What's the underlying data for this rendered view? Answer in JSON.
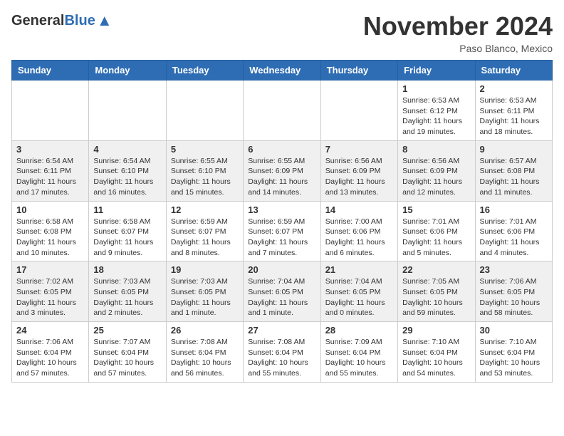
{
  "header": {
    "logo_general": "General",
    "logo_blue": "Blue",
    "month_title": "November 2024",
    "location": "Paso Blanco, Mexico"
  },
  "days_of_week": [
    "Sunday",
    "Monday",
    "Tuesday",
    "Wednesday",
    "Thursday",
    "Friday",
    "Saturday"
  ],
  "weeks": [
    [
      {
        "day": "",
        "info": ""
      },
      {
        "day": "",
        "info": ""
      },
      {
        "day": "",
        "info": ""
      },
      {
        "day": "",
        "info": ""
      },
      {
        "day": "",
        "info": ""
      },
      {
        "day": "1",
        "info": "Sunrise: 6:53 AM\nSunset: 6:12 PM\nDaylight: 11 hours and 19 minutes."
      },
      {
        "day": "2",
        "info": "Sunrise: 6:53 AM\nSunset: 6:11 PM\nDaylight: 11 hours and 18 minutes."
      }
    ],
    [
      {
        "day": "3",
        "info": "Sunrise: 6:54 AM\nSunset: 6:11 PM\nDaylight: 11 hours and 17 minutes."
      },
      {
        "day": "4",
        "info": "Sunrise: 6:54 AM\nSunset: 6:10 PM\nDaylight: 11 hours and 16 minutes."
      },
      {
        "day": "5",
        "info": "Sunrise: 6:55 AM\nSunset: 6:10 PM\nDaylight: 11 hours and 15 minutes."
      },
      {
        "day": "6",
        "info": "Sunrise: 6:55 AM\nSunset: 6:09 PM\nDaylight: 11 hours and 14 minutes."
      },
      {
        "day": "7",
        "info": "Sunrise: 6:56 AM\nSunset: 6:09 PM\nDaylight: 11 hours and 13 minutes."
      },
      {
        "day": "8",
        "info": "Sunrise: 6:56 AM\nSunset: 6:09 PM\nDaylight: 11 hours and 12 minutes."
      },
      {
        "day": "9",
        "info": "Sunrise: 6:57 AM\nSunset: 6:08 PM\nDaylight: 11 hours and 11 minutes."
      }
    ],
    [
      {
        "day": "10",
        "info": "Sunrise: 6:58 AM\nSunset: 6:08 PM\nDaylight: 11 hours and 10 minutes."
      },
      {
        "day": "11",
        "info": "Sunrise: 6:58 AM\nSunset: 6:07 PM\nDaylight: 11 hours and 9 minutes."
      },
      {
        "day": "12",
        "info": "Sunrise: 6:59 AM\nSunset: 6:07 PM\nDaylight: 11 hours and 8 minutes."
      },
      {
        "day": "13",
        "info": "Sunrise: 6:59 AM\nSunset: 6:07 PM\nDaylight: 11 hours and 7 minutes."
      },
      {
        "day": "14",
        "info": "Sunrise: 7:00 AM\nSunset: 6:06 PM\nDaylight: 11 hours and 6 minutes."
      },
      {
        "day": "15",
        "info": "Sunrise: 7:01 AM\nSunset: 6:06 PM\nDaylight: 11 hours and 5 minutes."
      },
      {
        "day": "16",
        "info": "Sunrise: 7:01 AM\nSunset: 6:06 PM\nDaylight: 11 hours and 4 minutes."
      }
    ],
    [
      {
        "day": "17",
        "info": "Sunrise: 7:02 AM\nSunset: 6:05 PM\nDaylight: 11 hours and 3 minutes."
      },
      {
        "day": "18",
        "info": "Sunrise: 7:03 AM\nSunset: 6:05 PM\nDaylight: 11 hours and 2 minutes."
      },
      {
        "day": "19",
        "info": "Sunrise: 7:03 AM\nSunset: 6:05 PM\nDaylight: 11 hours and 1 minute."
      },
      {
        "day": "20",
        "info": "Sunrise: 7:04 AM\nSunset: 6:05 PM\nDaylight: 11 hours and 1 minute."
      },
      {
        "day": "21",
        "info": "Sunrise: 7:04 AM\nSunset: 6:05 PM\nDaylight: 11 hours and 0 minutes."
      },
      {
        "day": "22",
        "info": "Sunrise: 7:05 AM\nSunset: 6:05 PM\nDaylight: 10 hours and 59 minutes."
      },
      {
        "day": "23",
        "info": "Sunrise: 7:06 AM\nSunset: 6:05 PM\nDaylight: 10 hours and 58 minutes."
      }
    ],
    [
      {
        "day": "24",
        "info": "Sunrise: 7:06 AM\nSunset: 6:04 PM\nDaylight: 10 hours and 57 minutes."
      },
      {
        "day": "25",
        "info": "Sunrise: 7:07 AM\nSunset: 6:04 PM\nDaylight: 10 hours and 57 minutes."
      },
      {
        "day": "26",
        "info": "Sunrise: 7:08 AM\nSunset: 6:04 PM\nDaylight: 10 hours and 56 minutes."
      },
      {
        "day": "27",
        "info": "Sunrise: 7:08 AM\nSunset: 6:04 PM\nDaylight: 10 hours and 55 minutes."
      },
      {
        "day": "28",
        "info": "Sunrise: 7:09 AM\nSunset: 6:04 PM\nDaylight: 10 hours and 55 minutes."
      },
      {
        "day": "29",
        "info": "Sunrise: 7:10 AM\nSunset: 6:04 PM\nDaylight: 10 hours and 54 minutes."
      },
      {
        "day": "30",
        "info": "Sunrise: 7:10 AM\nSunset: 6:04 PM\nDaylight: 10 hours and 53 minutes."
      }
    ]
  ]
}
